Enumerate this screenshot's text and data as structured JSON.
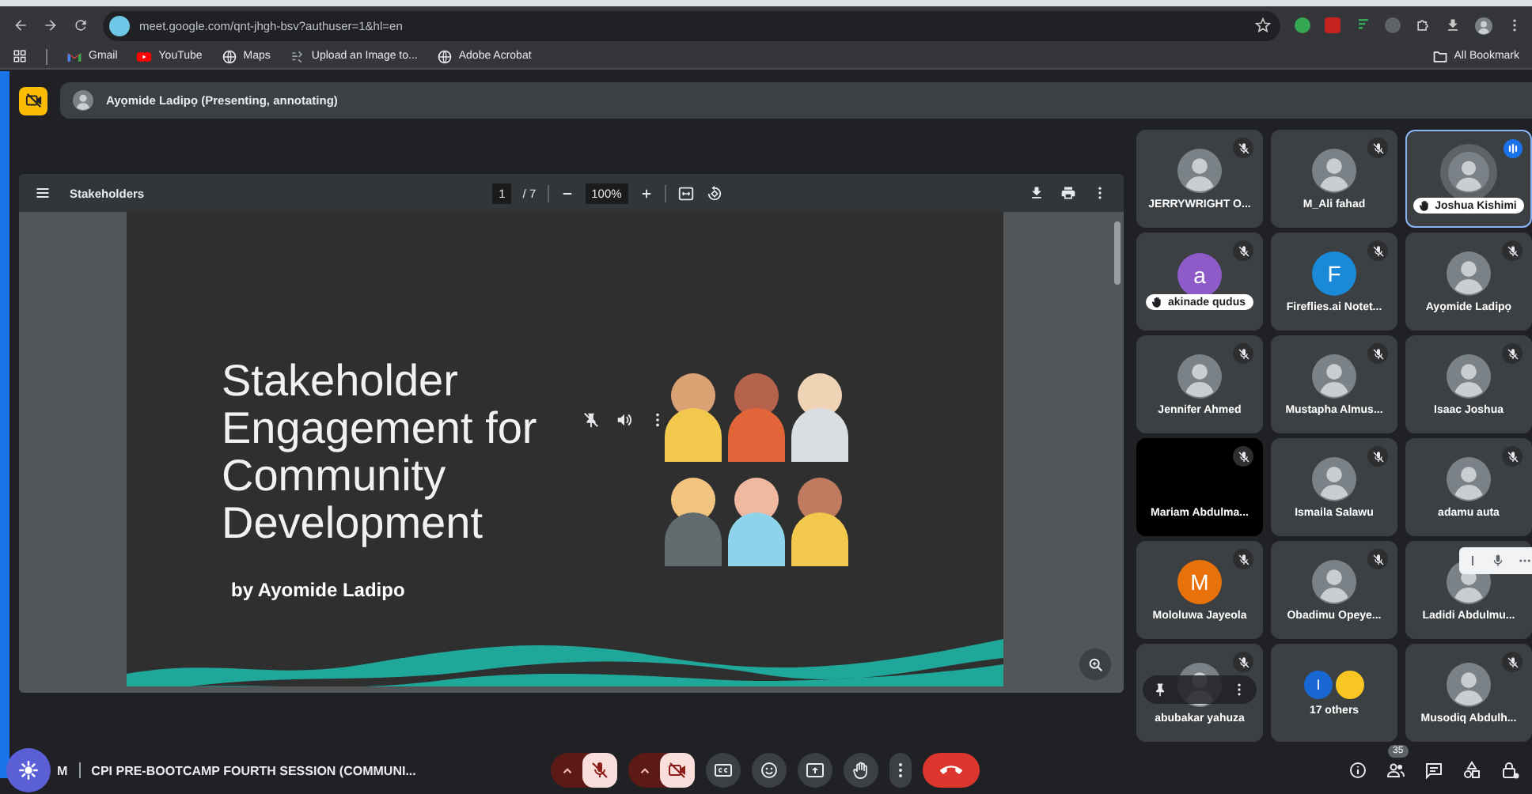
{
  "browser": {
    "url": "meet.google.com/qnt-jhgh-bsv?authuser=1&hl=en",
    "bookmarks": [
      {
        "label": "Gmail",
        "kind": "gmail"
      },
      {
        "label": "YouTube",
        "kind": "youtube"
      },
      {
        "label": "Maps",
        "kind": "globe"
      },
      {
        "label": "Upload an Image to...",
        "kind": "upload"
      },
      {
        "label": "Adobe Acrobat",
        "kind": "globe"
      }
    ],
    "all_bookmarks": "All Bookmark"
  },
  "presenter": {
    "label": "Ayọmide Ladipọ (Presenting, annotating)"
  },
  "pdf": {
    "title": "Stakeholders",
    "page": "1",
    "page_total": "/ 7",
    "zoom": "100%"
  },
  "slide": {
    "title": "Stakeholder Engagement for Community Development",
    "author": "by Ayomide Ladipo"
  },
  "tiles": [
    {
      "name": "JERRYWRIGHT O...",
      "kind": "photo",
      "muted": true,
      "speaking": false,
      "hand_raised": false
    },
    {
      "name": "M_Ali fahad",
      "kind": "photo",
      "muted": true,
      "speaking": false,
      "hand_raised": false
    },
    {
      "name": "Joshua Kishimi",
      "kind": "photo",
      "muted": false,
      "speaking": true,
      "hand_raised": true
    },
    {
      "name": "akinade qudus",
      "kind": "letter",
      "letter": "a",
      "color": "#8e5bc9",
      "muted": true,
      "speaking": false,
      "hand_raised": true
    },
    {
      "name": "Fireflies.ai Notet...",
      "kind": "letter",
      "letter": "F",
      "color": "#1a8ad8",
      "muted": true,
      "speaking": false,
      "hand_raised": false
    },
    {
      "name": "Ayọmide Ladipọ",
      "kind": "photo",
      "muted": true,
      "speaking": false,
      "hand_raised": false
    },
    {
      "name": "Jennifer Ahmed",
      "kind": "photo",
      "muted": true,
      "speaking": false,
      "hand_raised": false
    },
    {
      "name": "Mustapha Almus...",
      "kind": "photo",
      "muted": true,
      "speaking": false,
      "hand_raised": false
    },
    {
      "name": "Isaac Joshua",
      "kind": "photo",
      "muted": true,
      "speaking": false,
      "hand_raised": false
    },
    {
      "name": "Mariam Abdulma...",
      "kind": "blank",
      "muted": true,
      "speaking": false,
      "hand_raised": false
    },
    {
      "name": "Ismaila Salawu",
      "kind": "photo",
      "muted": true,
      "speaking": false,
      "hand_raised": false
    },
    {
      "name": "adamu auta",
      "kind": "photo",
      "muted": true,
      "speaking": false,
      "hand_raised": false
    },
    {
      "name": "Mololuwa Jayeola",
      "kind": "letter",
      "letter": "M",
      "color": "#e8710a",
      "muted": true,
      "speaking": false,
      "hand_raised": false
    },
    {
      "name": "Obadimu Opeye...",
      "kind": "photo",
      "muted": true,
      "speaking": false,
      "hand_raised": false
    },
    {
      "name": "Ladidi Abdulmu...",
      "kind": "photo",
      "muted": false,
      "speaking": false,
      "hand_raised": false,
      "overlay": {
        "kind": "mic-toolbar"
      }
    },
    {
      "name": "abubakar yahuza",
      "kind": "photo",
      "muted": true,
      "speaking": false,
      "hand_raised": false,
      "overlay": {
        "kind": "tile-menu"
      }
    },
    {
      "name": "17 others",
      "kind": "group",
      "letter": "I",
      "color": "#1967d2",
      "muted": false,
      "speaking": false,
      "hand_raised": false
    },
    {
      "name": "Musodiq Abdulh...",
      "kind": "photo",
      "muted": true,
      "speaking": false,
      "hand_raised": false
    }
  ],
  "bottom_bar": {
    "clock": "M",
    "meeting_title": "CPI PRE-BOOTCAMP FOURTH SESSION (COMMUNI...",
    "mic_on": false,
    "camera_on": false,
    "participant_count": "35"
  }
}
